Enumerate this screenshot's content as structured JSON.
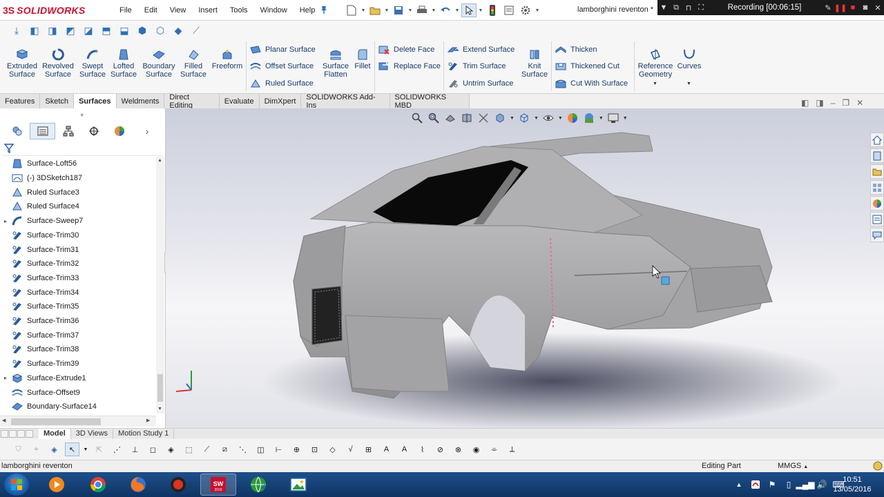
{
  "app": {
    "brand_prefix": "3S",
    "brand_name": "SOLIDWORKS",
    "document_title": "lamborghini reventon *",
    "recording_label": "Recording [00:06:15]"
  },
  "menu": [
    "File",
    "Edit",
    "View",
    "Insert",
    "Tools",
    "Window",
    "Help"
  ],
  "ribbon": {
    "big_tools": [
      {
        "line1": "Extruded",
        "line2": "Surface"
      },
      {
        "line1": "Revolved",
        "line2": "Surface"
      },
      {
        "line1": "Swept",
        "line2": "Surface"
      },
      {
        "line1": "Lofted",
        "line2": "Surface"
      },
      {
        "line1": "Boundary",
        "line2": "Surface"
      },
      {
        "line1": "Filled",
        "line2": "Surface"
      },
      {
        "line1": "Freeform",
        "line2": ""
      }
    ],
    "col1": [
      "Planar Surface",
      "Offset Surface",
      "Ruled Surface"
    ],
    "flatten": {
      "line1": "Surface",
      "line2": "Flatten"
    },
    "fillet": "Fillet",
    "col2": [
      "Delete Face",
      "Replace Face"
    ],
    "col3": [
      "Extend Surface",
      "Trim Surface",
      "Untrim Surface"
    ],
    "knit": {
      "line1": "Knit",
      "line2": "Surface"
    },
    "col4": [
      "Thicken",
      "Thickened Cut",
      "Cut With Surface"
    ],
    "refgeom": {
      "line1": "Reference",
      "line2": "Geometry"
    },
    "curves": "Curves"
  },
  "tabs": [
    {
      "label": "Features",
      "active": false
    },
    {
      "label": "Sketch",
      "active": false
    },
    {
      "label": "Surfaces",
      "active": true
    },
    {
      "label": "Weldments",
      "active": false
    },
    {
      "label": "Direct Editing",
      "active": false
    },
    {
      "label": "Evaluate",
      "active": false
    },
    {
      "label": "DimXpert",
      "active": false
    },
    {
      "label": "SOLIDWORKS Add-Ins",
      "active": false
    },
    {
      "label": "SOLIDWORKS MBD",
      "active": false
    }
  ],
  "tree": [
    {
      "label": "Surface-Loft56",
      "icon": "loft-surface-icon",
      "expandable": false
    },
    {
      "label": "(-) 3DSketch187",
      "icon": "3d-sketch-icon",
      "expandable": false
    },
    {
      "label": "Ruled Surface3",
      "icon": "ruled-surface-icon",
      "expandable": false
    },
    {
      "label": "Ruled Surface4",
      "icon": "ruled-surface-icon",
      "expandable": false
    },
    {
      "label": "Surface-Sweep7",
      "icon": "sweep-surface-icon",
      "expandable": true
    },
    {
      "label": "Surface-Trim30",
      "icon": "trim-surface-icon",
      "expandable": false
    },
    {
      "label": "Surface-Trim31",
      "icon": "trim-surface-icon",
      "expandable": false
    },
    {
      "label": "Surface-Trim32",
      "icon": "trim-surface-icon",
      "expandable": false
    },
    {
      "label": "Surface-Trim33",
      "icon": "trim-surface-icon",
      "expandable": false
    },
    {
      "label": "Surface-Trim34",
      "icon": "trim-surface-icon",
      "expandable": false
    },
    {
      "label": "Surface-Trim35",
      "icon": "trim-surface-icon",
      "expandable": false
    },
    {
      "label": "Surface-Trim36",
      "icon": "trim-surface-icon",
      "expandable": false
    },
    {
      "label": "Surface-Trim37",
      "icon": "trim-surface-icon",
      "expandable": false
    },
    {
      "label": "Surface-Trim38",
      "icon": "trim-surface-icon",
      "expandable": false
    },
    {
      "label": "Surface-Trim39",
      "icon": "trim-surface-icon",
      "expandable": false
    },
    {
      "label": "Surface-Extrude1",
      "icon": "extrude-surface-icon",
      "expandable": true
    },
    {
      "label": "Surface-Offset9",
      "icon": "offset-surface-icon",
      "expandable": false
    },
    {
      "label": "Boundary-Surface14",
      "icon": "boundary-surface-icon",
      "expandable": false
    }
  ],
  "model_tabs": [
    {
      "label": "Model",
      "active": true
    },
    {
      "label": "3D Views",
      "active": false
    },
    {
      "label": "Motion Study 1",
      "active": false
    }
  ],
  "status": {
    "filename": "lamborghini reventon",
    "mode": "Editing Part",
    "units": "MMGS"
  },
  "clock": {
    "time": "10:51",
    "date": "13/05/2016"
  },
  "colors": {
    "brand": "#c8102e",
    "accent": "#2f6fb5",
    "taskbar": "#0f3463"
  }
}
